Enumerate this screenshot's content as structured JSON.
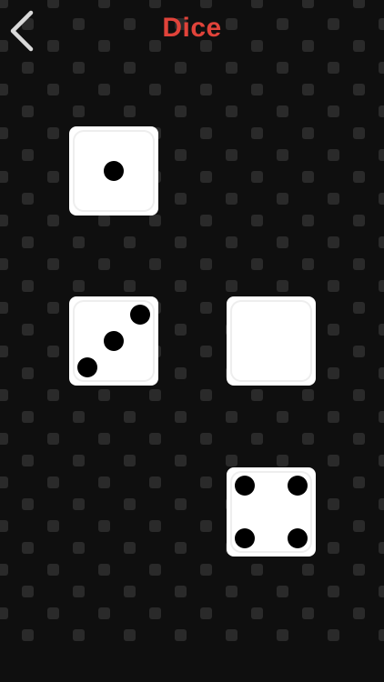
{
  "header": {
    "title": "Dice",
    "back_icon": "chevron-left-icon"
  },
  "colors": {
    "title": "#e0433a",
    "background": "#0f0f0f",
    "pattern_tile": "#2a2a2a",
    "die_face": "#ffffff",
    "pip": "#000000",
    "back_chevron": "#d9d9d9"
  },
  "dice": [
    {
      "name": "die-1",
      "value": 1
    },
    {
      "name": "die-2",
      "value": 3
    },
    {
      "name": "die-3",
      "value": 0
    },
    {
      "name": "die-4",
      "value": 4
    }
  ]
}
